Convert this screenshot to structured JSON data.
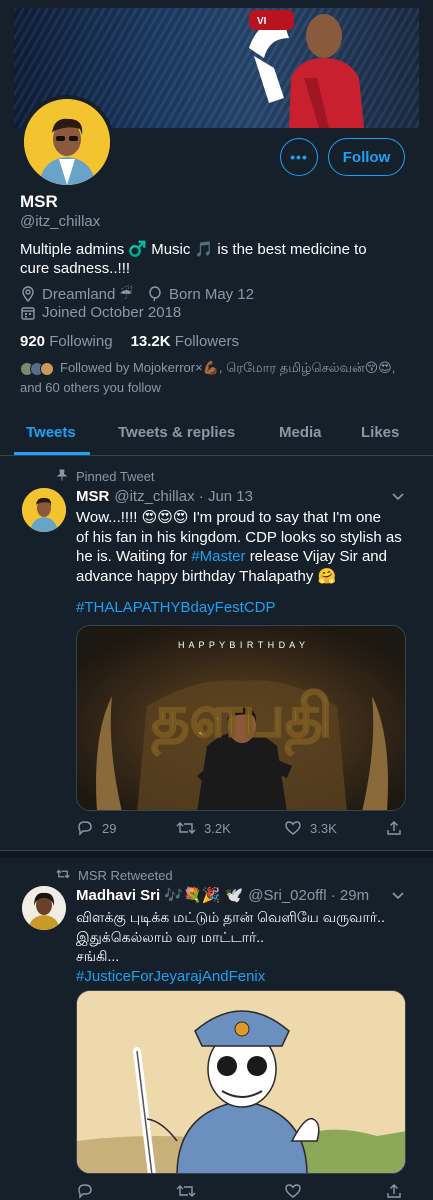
{
  "profile": {
    "name": "MSR",
    "handle": "@itz_chillax",
    "bio_line1": "Multiple admins ♂️ Music 🎵 is the best medicine to",
    "bio_line2": "cure sadness..!!!",
    "location": "Dreamland ☔",
    "birthday": "Born May 12",
    "joined": "Joined October 2018",
    "following_count": "920",
    "following_label": "Following",
    "followers_count": "13.2K",
    "followers_label": "Followers",
    "followed_by_line1": "Followed by Mojokerror×💪🏾, ரெமாேர தமிழ்செல்வன்😚😍,",
    "followed_by_line2": "and 60 others you follow",
    "more_label": "•••",
    "follow_label": "Follow"
  },
  "tabs": [
    {
      "label": "Tweets",
      "active": true
    },
    {
      "label": "Tweets & replies",
      "active": false
    },
    {
      "label": "Media",
      "active": false
    },
    {
      "label": "Likes",
      "active": false
    }
  ],
  "tweets": [
    {
      "context": "Pinned Tweet",
      "author_name": "MSR",
      "author_handle": "@itz_chillax",
      "time": "· Jun 13",
      "text_line1": "Wow...!!!! 😍😍😍 I'm proud to say that I'm one",
      "text_line2": "of his fan in his kingdom. CDP looks so stylish as",
      "text_line3": "he is. Waiting for",
      "hashtag_inline": "#Master",
      "text_line3b": "release Vijay Sir and",
      "text_line4": "advance happy birthday Thalapathy 🤗",
      "hashtag": "#THALAPATHYBdayFestCDP",
      "media_caption": "H A P P Y   B I R T H D A Y",
      "media_title": "தளபதி",
      "replies": "29",
      "retweets": "3.2K",
      "likes": "3.3K"
    },
    {
      "context": "MSR Retweeted",
      "author_name": "Madhavi Sri 🎶💐🎉 🕊️",
      "author_handle": "@Sri_02offl",
      "time": "· 29m",
      "text_line1": "விளக்கு புடிக்க மட்டும் தான் வெளியே வருவார்..",
      "text_line2": "இதுக்கெல்லாம் வர மாட்டார்..",
      "text_line3": "சங்கி...",
      "hashtag": "#JusticeForJeyarajAndFenix"
    }
  ],
  "colors": {
    "background": "#15202b",
    "accent": "#1da1f2",
    "muted": "#8899a6",
    "border": "#38444d"
  }
}
